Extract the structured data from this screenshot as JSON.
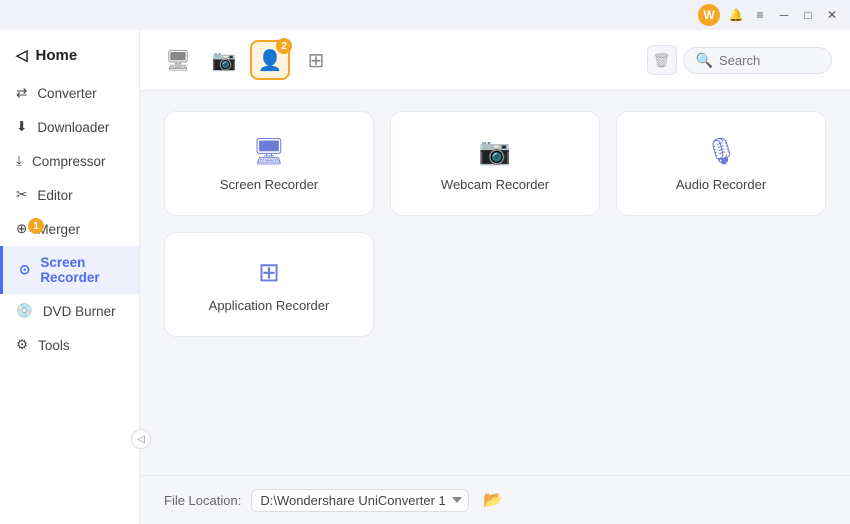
{
  "titlebar": {
    "minimize_label": "─",
    "maximize_label": "□",
    "close_label": "✕",
    "menu_label": "≡",
    "bell_label": "🔔"
  },
  "sidebar": {
    "home_label": "Home",
    "items": [
      {
        "id": "converter",
        "label": "Converter",
        "active": false,
        "badge": null
      },
      {
        "id": "downloader",
        "label": "Downloader",
        "active": false,
        "badge": null
      },
      {
        "id": "compressor",
        "label": "Compressor",
        "active": false,
        "badge": null
      },
      {
        "id": "editor",
        "label": "Editor",
        "active": false,
        "badge": null
      },
      {
        "id": "merger",
        "label": "Merger",
        "active": false,
        "badge": "1"
      },
      {
        "id": "screen-recorder",
        "label": "Screen Recorder",
        "active": true,
        "badge": null
      },
      {
        "id": "dvd-burner",
        "label": "DVD Burner",
        "active": false,
        "badge": null
      },
      {
        "id": "tools",
        "label": "Tools",
        "active": false,
        "badge": null
      }
    ]
  },
  "toolbar": {
    "tabs": [
      {
        "id": "screen",
        "icon": "🖥",
        "active": false,
        "badge": null
      },
      {
        "id": "webcam",
        "icon": "📷",
        "active": false,
        "badge": null
      },
      {
        "id": "app-recorder",
        "icon": "👤",
        "active": true,
        "badge": "2"
      },
      {
        "id": "more",
        "icon": "⊞",
        "active": false,
        "badge": null
      }
    ],
    "search_placeholder": "Search"
  },
  "grid": {
    "rows": [
      [
        {
          "id": "screen-recorder",
          "label": "Screen Recorder",
          "icon": "🖥"
        },
        {
          "id": "webcam-recorder",
          "label": "Webcam Recorder",
          "icon": "📷"
        },
        {
          "id": "audio-recorder",
          "label": "Audio Recorder",
          "icon": "🎙"
        }
      ],
      [
        {
          "id": "app-recorder",
          "label": "Application Recorder",
          "icon": "⊞"
        }
      ]
    ]
  },
  "footer": {
    "label": "File Location:",
    "path": "D:\\Wondershare UniConverter 1",
    "path_options": [
      "D:\\Wondershare UniConverter 1"
    ]
  }
}
